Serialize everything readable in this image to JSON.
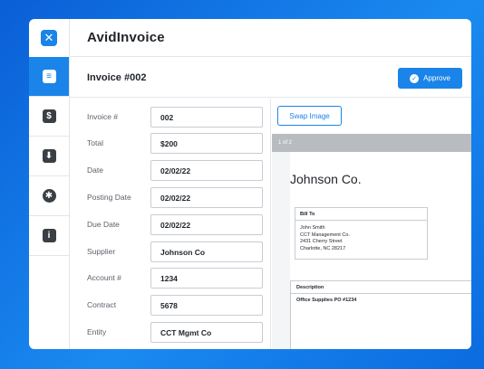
{
  "app": {
    "title": "AvidInvoice"
  },
  "sidebar": {
    "items": [
      {
        "name": "invoice-icon",
        "glyph": "≡"
      },
      {
        "name": "dollar-icon",
        "glyph": "$"
      },
      {
        "name": "inbox-download-icon",
        "glyph": "⬇"
      },
      {
        "name": "settings-gear-icon",
        "glyph": "✱"
      },
      {
        "name": "info-icon",
        "glyph": "i"
      }
    ]
  },
  "invoice": {
    "title": "Invoice #002",
    "approve_label": "Approve"
  },
  "form": {
    "invoice_number": {
      "label": "Invoice #",
      "value": "002"
    },
    "total": {
      "label": "Total",
      "value": "$200"
    },
    "date": {
      "label": "Date",
      "value": "02/02/22"
    },
    "posting_date": {
      "label": "Posting Date",
      "value": "02/02/22"
    },
    "due_date": {
      "label": "Due Date",
      "value": "02/02/22"
    },
    "supplier": {
      "label": "Supplier",
      "value": "Johnson Co"
    },
    "account": {
      "label": "Account #",
      "value": "1234"
    },
    "contract": {
      "label": "Contract",
      "value": "5678"
    },
    "entity": {
      "label": "Entity",
      "value": "CCT Mgmt Co"
    }
  },
  "viewer": {
    "swap_label": "Swap Image",
    "page_indicator": "1 of 2",
    "company": "Johnson Co.",
    "bill_to": {
      "heading": "Bill To",
      "lines": [
        "John Smith",
        "CCT Management Co.",
        "2431 Cherry Street",
        "Charlotte, NC 28217"
      ]
    },
    "description": {
      "heading": "Description",
      "line": "Office Supplies PO #1234"
    }
  },
  "colors": {
    "accent": "#1a84e8",
    "background": "#0a5fd6"
  }
}
